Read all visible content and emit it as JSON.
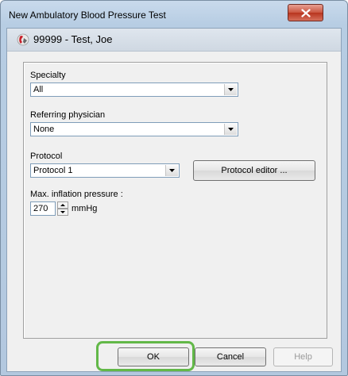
{
  "window": {
    "title": "New Ambulatory Blood Pressure Test",
    "close_icon": "close-icon"
  },
  "patient": {
    "display": "99999 - Test, Joe",
    "icon": "patient-icon"
  },
  "form": {
    "specialty": {
      "label": "Specialty",
      "value": "All"
    },
    "referring_physician": {
      "label": "Referring physician",
      "value": "None"
    },
    "protocol": {
      "label": "Protocol",
      "value": "Protocol 1",
      "editor_button": "Protocol editor ..."
    },
    "max_inflation": {
      "label": "Max. inflation pressure :",
      "value": "270",
      "unit": "mmHg"
    }
  },
  "buttons": {
    "ok": "OK",
    "cancel": "Cancel",
    "help": "Help"
  },
  "colors": {
    "highlight": "#62b848",
    "close_button": "#c9543f"
  }
}
